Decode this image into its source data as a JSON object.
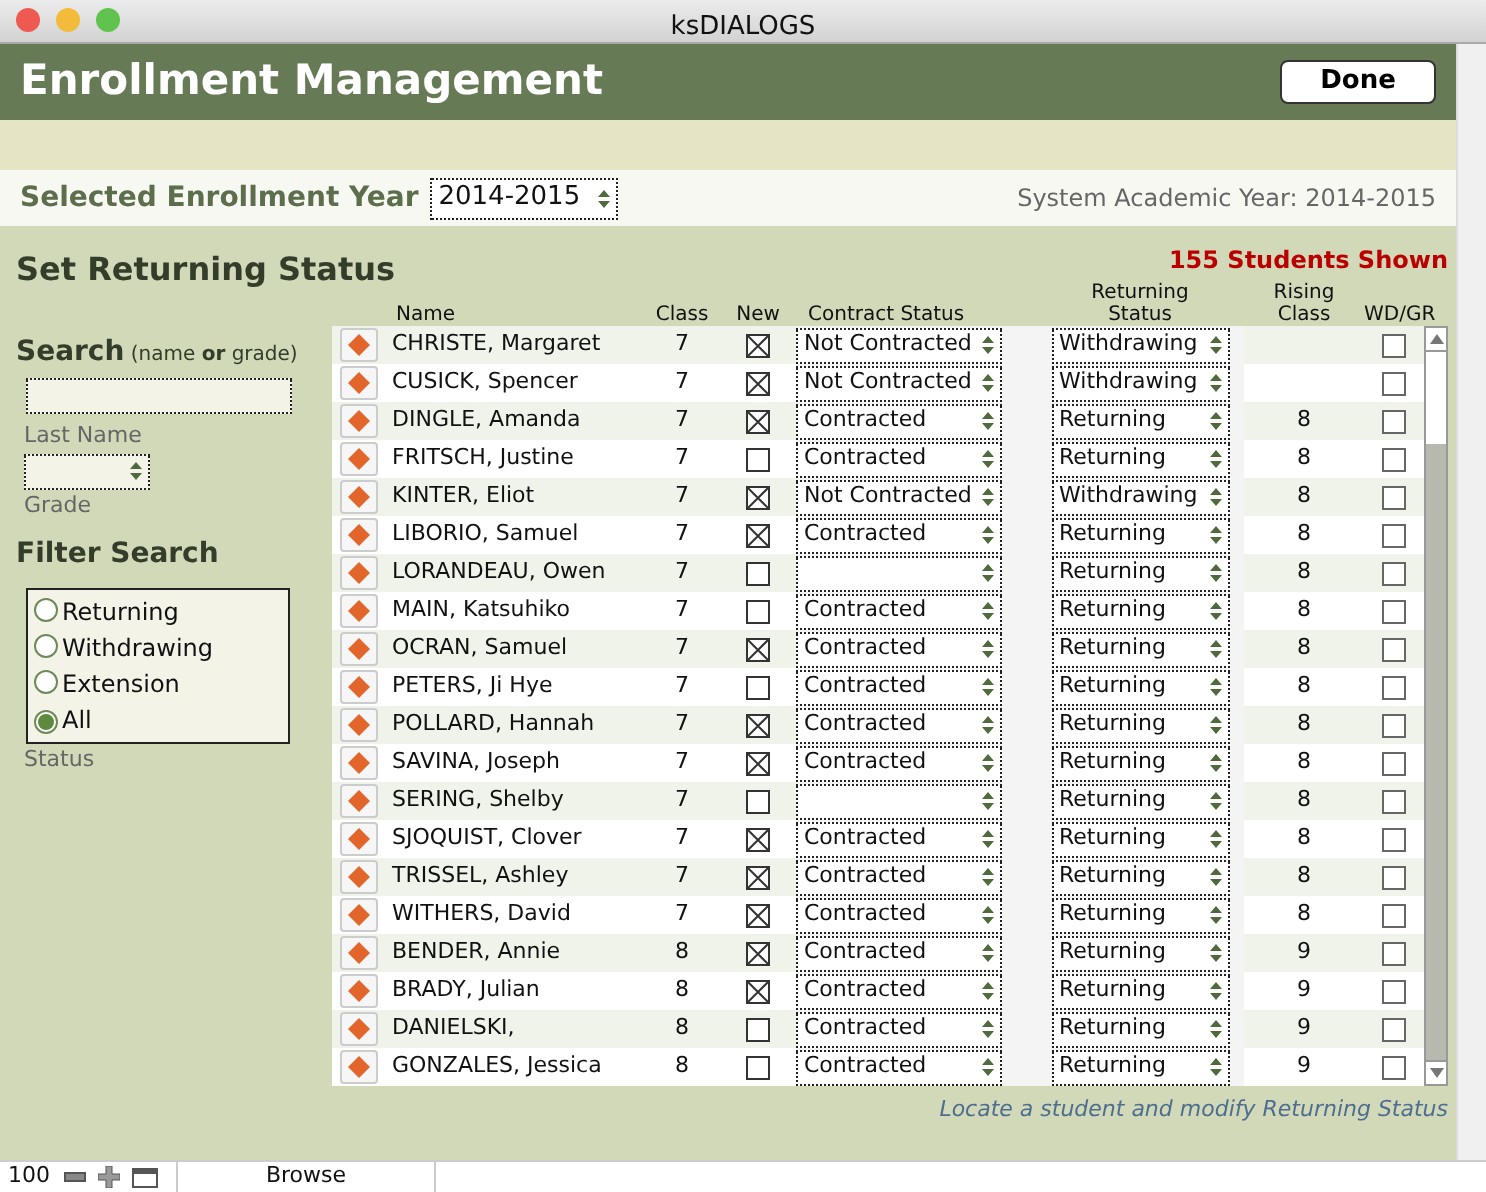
{
  "window": {
    "title": "ksDIALOGS"
  },
  "header": {
    "title": "Enrollment Management",
    "done_button": "Done"
  },
  "year_bar": {
    "label": "Selected Enrollment Year",
    "year": "2014-2015",
    "system_year": "System Academic Year: 2014-2015"
  },
  "section_title": "Set Returning Status",
  "shown_count": "155 Students Shown",
  "search": {
    "title": "Search",
    "hint": "(name **or** grade)",
    "last_name_label": "Last Name",
    "grade_label": "Grade"
  },
  "filter": {
    "title": "Filter Search",
    "options": [
      {
        "label": "Returning",
        "selected": false
      },
      {
        "label": "Withdrawing",
        "selected": false
      },
      {
        "label": "Extension",
        "selected": false
      },
      {
        "label": "All",
        "selected": true
      }
    ],
    "caption": "Status"
  },
  "table": {
    "columns": [
      "Name",
      "Class",
      "New",
      "Contract Status",
      "Returning Status",
      "Rising Class",
      "WD/GR"
    ],
    "rows": [
      {
        "name": "CHRISTE, Margaret",
        "class": "7",
        "new": true,
        "contract": "Not Contracted",
        "returning": "Withdrawing",
        "wd": false
      },
      {
        "name": "CUSICK, Spencer",
        "class": "7",
        "new": true,
        "contract": "Not Contracted",
        "returning": "Withdrawing",
        "wd": false
      },
      {
        "name": "DINGLE, Amanda",
        "class": "7",
        "new": true,
        "contract": "Contracted",
        "returning": "Returning",
        "rising": "8",
        "wd": false
      },
      {
        "name": "FRITSCH, Justine",
        "class": "7",
        "new": false,
        "contract": "Contracted",
        "returning": "Returning",
        "rising": "8",
        "wd": false
      },
      {
        "name": "KINTER, Eliot",
        "class": "7",
        "new": true,
        "contract": "Not Contracted",
        "returning": "Withdrawing",
        "rising": "8",
        "wd": false
      },
      {
        "name": "LIBORIO, Samuel",
        "class": "7",
        "new": true,
        "contract": "Contracted",
        "returning": "Returning",
        "rising": "8",
        "wd": false
      },
      {
        "name": "LORANDEAU, Owen",
        "class": "7",
        "new": false,
        "returning": "Returning",
        "rising": "8",
        "wd": false
      },
      {
        "name": "MAIN, Katsuhiko",
        "class": "7",
        "new": false,
        "contract": "Contracted",
        "returning": "Returning",
        "rising": "8",
        "wd": false
      },
      {
        "name": "OCRAN, Samuel",
        "class": "7",
        "new": true,
        "contract": "Contracted",
        "returning": "Returning",
        "rising": "8",
        "wd": false
      },
      {
        "name": "PETERS, Ji Hye",
        "class": "7",
        "new": false,
        "contract": "Contracted",
        "returning": "Returning",
        "rising": "8",
        "wd": false
      },
      {
        "name": "POLLARD, Hannah",
        "class": "7",
        "new": true,
        "contract": "Contracted",
        "returning": "Returning",
        "rising": "8",
        "wd": false
      },
      {
        "name": "SAVINA, Joseph",
        "class": "7",
        "new": true,
        "contract": "Contracted",
        "returning": "Returning",
        "rising": "8",
        "wd": false
      },
      {
        "name": "SERING, Shelby",
        "class": "7",
        "new": false,
        "returning": "Returning",
        "rising": "8",
        "wd": false
      },
      {
        "name": "SJOQUIST, Clover",
        "class": "7",
        "new": true,
        "contract": "Contracted",
        "returning": "Returning",
        "rising": "8",
        "wd": false
      },
      {
        "name": "TRISSEL, Ashley",
        "class": "7",
        "new": true,
        "contract": "Contracted",
        "returning": "Returning",
        "rising": "8",
        "wd": false
      },
      {
        "name": "WITHERS, David",
        "class": "7",
        "new": true,
        "contract": "Contracted",
        "returning": "Returning",
        "rising": "8",
        "wd": false
      },
      {
        "name": "BENDER, Annie",
        "class": "8",
        "new": true,
        "contract": "Contracted",
        "returning": "Returning",
        "rising": "9",
        "wd": false
      },
      {
        "name": "BRADY, Julian",
        "class": "8",
        "new": true,
        "contract": "Contracted",
        "returning": "Returning",
        "rising": "9",
        "wd": false
      },
      {
        "name": "DANIELSKI,",
        "class": "8",
        "new": false,
        "contract": "Contracted",
        "returning": "Returning",
        "rising": "9",
        "wd": false
      },
      {
        "name": "GONZALES, Jessica",
        "class": "8",
        "new": false,
        "contract": "Contracted",
        "returning": "Returning",
        "rising": "9",
        "wd": false
      }
    ]
  },
  "hint": "Locate a student and modify Returning Status",
  "status_bar": {
    "zoom": "100",
    "mode": "Browse"
  }
}
